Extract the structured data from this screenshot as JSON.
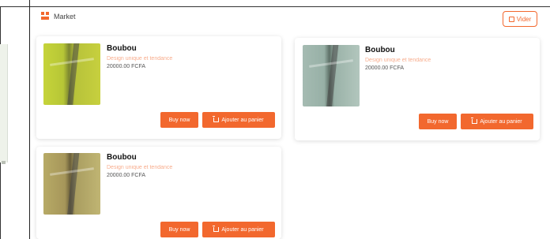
{
  "header": {
    "app_label": "Market",
    "action_label": "Vider"
  },
  "products": [
    {
      "name": "Boubou",
      "description": "Design unique et tendance",
      "price": "20000.00 FCFA",
      "buy_label": "Buy now",
      "cart_label": "Ajouter au panier"
    },
    {
      "name": "Boubou",
      "description": "Design unique et tendance",
      "price": "20000.00 FCFA",
      "buy_label": "Buy now",
      "cart_label": "Ajouter au panier"
    },
    {
      "name": "Boubou",
      "description": "Design unique et tendance",
      "price": "20000.00 FCFA",
      "buy_label": "Buy now",
      "cart_label": "Ajouter au panier"
    }
  ],
  "colors": {
    "accent": "#f2682e",
    "surface": "#ffffff"
  }
}
